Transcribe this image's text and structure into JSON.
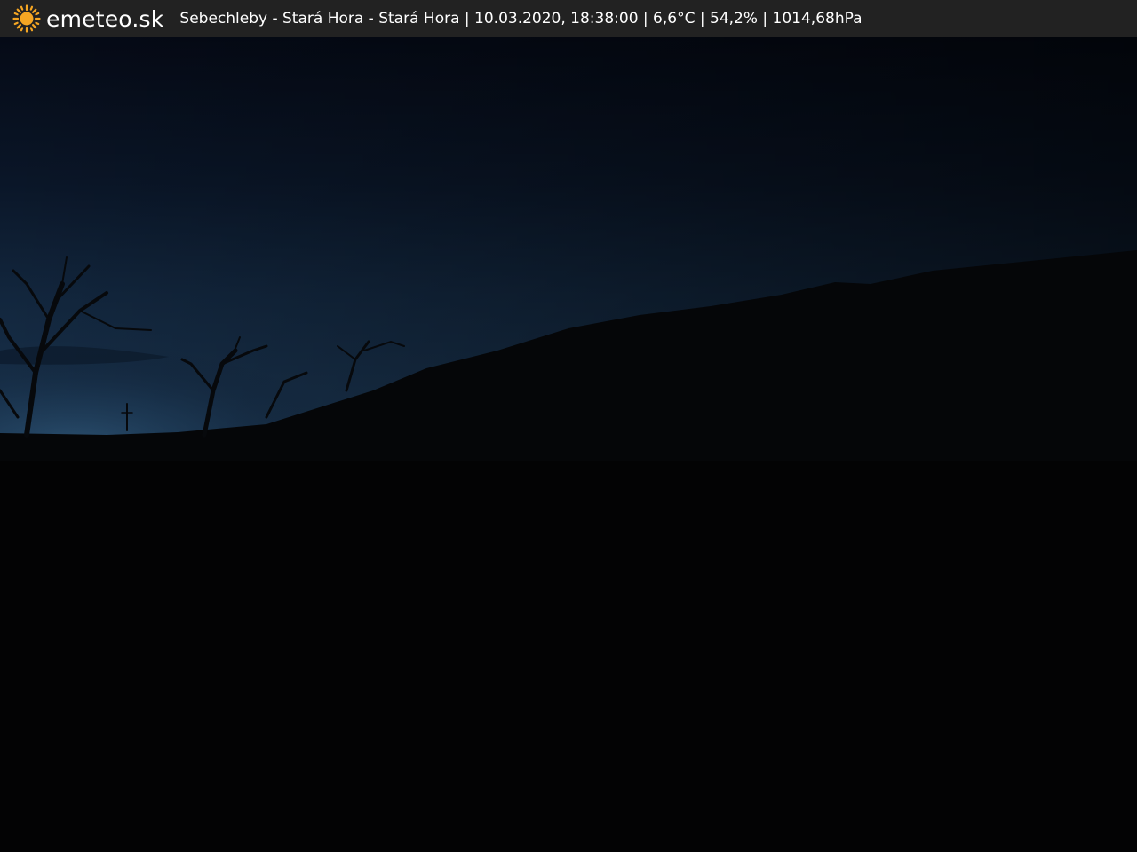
{
  "header": {
    "brand": "emeteo.sk",
    "logo_icon": "sun-icon",
    "caption": "Sebechleby - Stará Hora - Stará Hora | 10.03.2020, 18:38:00 | 6,6°C | 54,2% | 1014,68hPa"
  },
  "colors": {
    "bar_background": "#222222",
    "sun": "#f5a623",
    "sky_top": "#06101f",
    "sky_horizon": "#1d3550",
    "ground": "#030304"
  }
}
